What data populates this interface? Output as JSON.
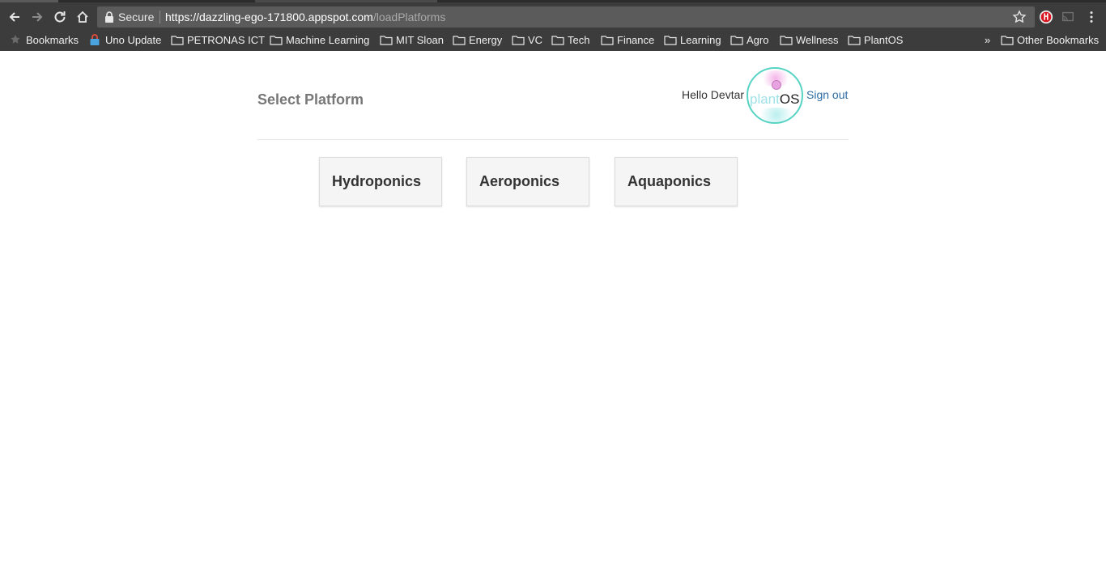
{
  "browser": {
    "secure_label": "Secure",
    "url_host": "https://dazzling-ego-171800.appspot.com",
    "url_path": "/loadPlatforms",
    "bookmarks": [
      {
        "label": "Bookmarks",
        "icon": "star-icon"
      },
      {
        "label": "Uno Update",
        "icon": "lock-icon"
      },
      {
        "label": "PETRONAS ICT",
        "icon": "folder-icon"
      },
      {
        "label": "Machine Learning",
        "icon": "folder-icon"
      },
      {
        "label": "MIT Sloan",
        "icon": "folder-icon"
      },
      {
        "label": "Energy",
        "icon": "folder-icon"
      },
      {
        "label": "VC",
        "icon": "folder-icon"
      },
      {
        "label": "Tech",
        "icon": "folder-icon"
      },
      {
        "label": "Finance",
        "icon": "folder-icon"
      },
      {
        "label": "Learning",
        "icon": "folder-icon"
      },
      {
        "label": "Agro",
        "icon": "folder-icon"
      },
      {
        "label": "Wellness",
        "icon": "folder-icon"
      },
      {
        "label": "PlantOS",
        "icon": "folder-icon"
      }
    ],
    "overflow_label": "»",
    "other_bookmarks": "Other Bookmarks"
  },
  "page": {
    "title": "Select Platform",
    "greeting": "Hello Devtar",
    "logo_word_1": "plant",
    "logo_word_2": "OS",
    "signout": "Sign out",
    "platforms": [
      {
        "label": "Hydroponics"
      },
      {
        "label": "Aeroponics"
      },
      {
        "label": "Aquaponics"
      }
    ]
  },
  "colors": {
    "accent_link": "#2e6da4",
    "logo_ring": "#57d3c4",
    "chrome_bg": "#3c3c3c"
  }
}
